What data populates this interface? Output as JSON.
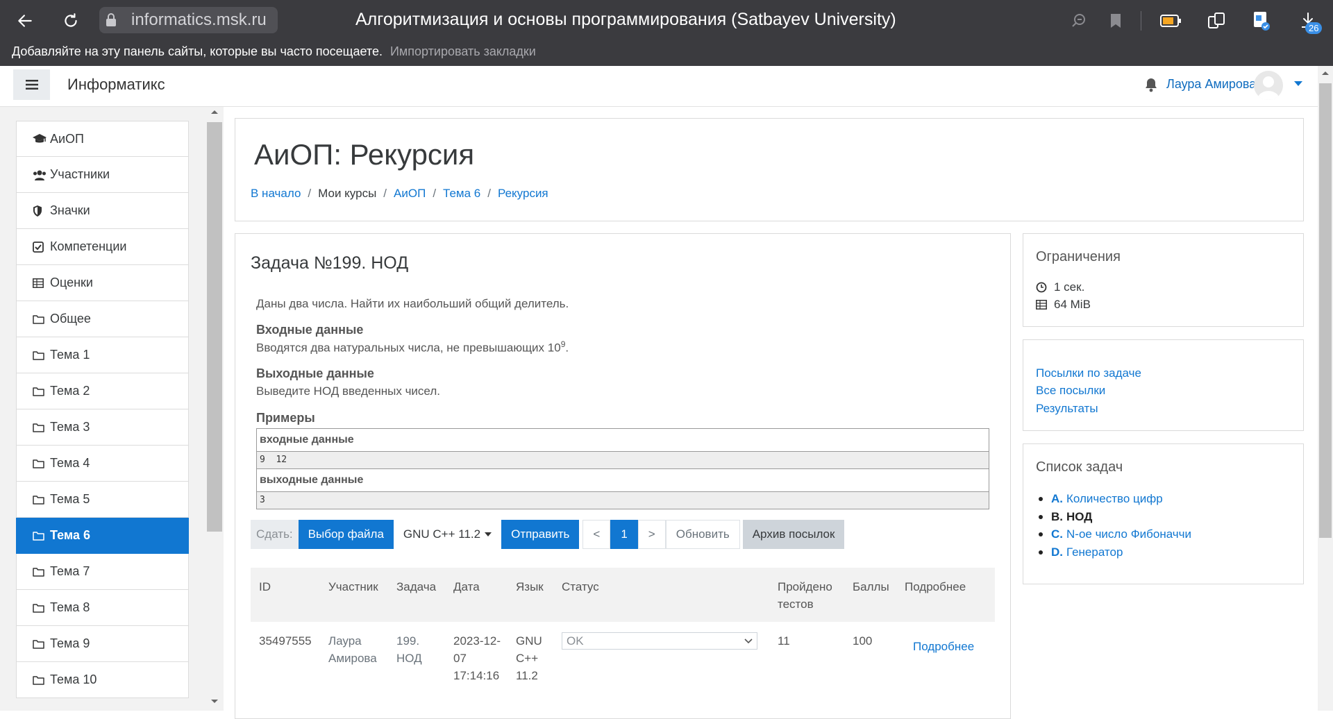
{
  "browser": {
    "url": "informatics.msk.ru",
    "tab_title": "Алгоритмизация и основы программирования (Satbayev University)",
    "download_count": "26",
    "bookmarks_bar": {
      "hint": "Добавляйте на эту панель сайты, которые вы часто посещаете.",
      "import_link": "Импортировать закладки"
    }
  },
  "navbar": {
    "site_name": "Информатикс",
    "user_name": "Лаура Амирова"
  },
  "sidebar": {
    "items": [
      {
        "label": "АиОП",
        "icon": "graduation-cap-icon"
      },
      {
        "label": "Участники",
        "icon": "users-icon"
      },
      {
        "label": "Значки",
        "icon": "shield-icon"
      },
      {
        "label": "Компетенции",
        "icon": "check-square-icon"
      },
      {
        "label": "Оценки",
        "icon": "table-icon"
      },
      {
        "label": "Общее",
        "icon": "folder-icon"
      },
      {
        "label": "Тема 1",
        "icon": "folder-icon"
      },
      {
        "label": "Тема 2",
        "icon": "folder-icon"
      },
      {
        "label": "Тема 3",
        "icon": "folder-icon"
      },
      {
        "label": "Тема 4",
        "icon": "folder-icon"
      },
      {
        "label": "Тема 5",
        "icon": "folder-icon"
      },
      {
        "label": "Тема 6",
        "icon": "folder-icon",
        "active": true
      },
      {
        "label": "Тема 7",
        "icon": "folder-icon"
      },
      {
        "label": "Тема 8",
        "icon": "folder-icon"
      },
      {
        "label": "Тема 9",
        "icon": "folder-icon"
      },
      {
        "label": "Тема 10",
        "icon": "folder-icon"
      }
    ]
  },
  "header": {
    "title": "АиОП: Рекурсия",
    "breadcrumb": {
      "home": "В начало",
      "my_courses": "Мои курсы",
      "course": "АиОП",
      "topic": "Тема 6",
      "page": "Рекурсия",
      "separator": "/"
    }
  },
  "problem": {
    "title": "Задача №199. НОД",
    "statement": "Даны два числа. Найти их наибольший общий делитель.",
    "input_heading": "Входные данные",
    "input_text": "Вводятся два натуральных числа, не превышающих 10",
    "input_exp": "9",
    "input_tail": ".",
    "output_heading": "Выходные данные",
    "output_text": "Выведите НОД введенных чисел.",
    "examples_heading": "Примеры",
    "example": {
      "input_label": "входные данные",
      "input_value": "9  12",
      "output_label": "выходные данные",
      "output_value": "3"
    }
  },
  "submit": {
    "label": "Сдать:",
    "file_button": "Выбор файла",
    "language": "GNU C++ 11.2",
    "submit_button": "Отправить",
    "prev": "<",
    "page": "1",
    "next": ">",
    "refresh": "Обновить",
    "archive": "Архив посылок"
  },
  "submissions": {
    "headers": {
      "id": "ID",
      "participant": "Участник",
      "task": "Задача",
      "date": "Дата",
      "lang": "Язык",
      "status": "Статус",
      "tests": "Пройдено тестов",
      "score": "Баллы",
      "details": "Подробнее"
    },
    "row": {
      "id": "35497555",
      "participant": "Лаура Амирова",
      "task": "199. НОД",
      "date": "2023-12-07 17:14:16",
      "lang": "GNU C++ 11.2",
      "status": "OK",
      "tests": "11",
      "score": "100",
      "details": "Подробнее"
    }
  },
  "limits": {
    "title": "Ограничения",
    "time": "1 сек.",
    "memory": "64 MiB"
  },
  "links": {
    "by_task": "Посылки по задаче",
    "all": "Все посылки",
    "results": "Результаты"
  },
  "tasks": {
    "title": "Список задач",
    "items": [
      {
        "letter": "A.",
        "name": "Количество цифр"
      },
      {
        "letter": "B.",
        "name": "НОД",
        "current": true
      },
      {
        "letter": "C.",
        "name": "N-ое число Фибоначчи"
      },
      {
        "letter": "D.",
        "name": "Генератор"
      }
    ]
  },
  "colors": {
    "accent": "#1177d1",
    "chrome": "#3b3b3f"
  }
}
